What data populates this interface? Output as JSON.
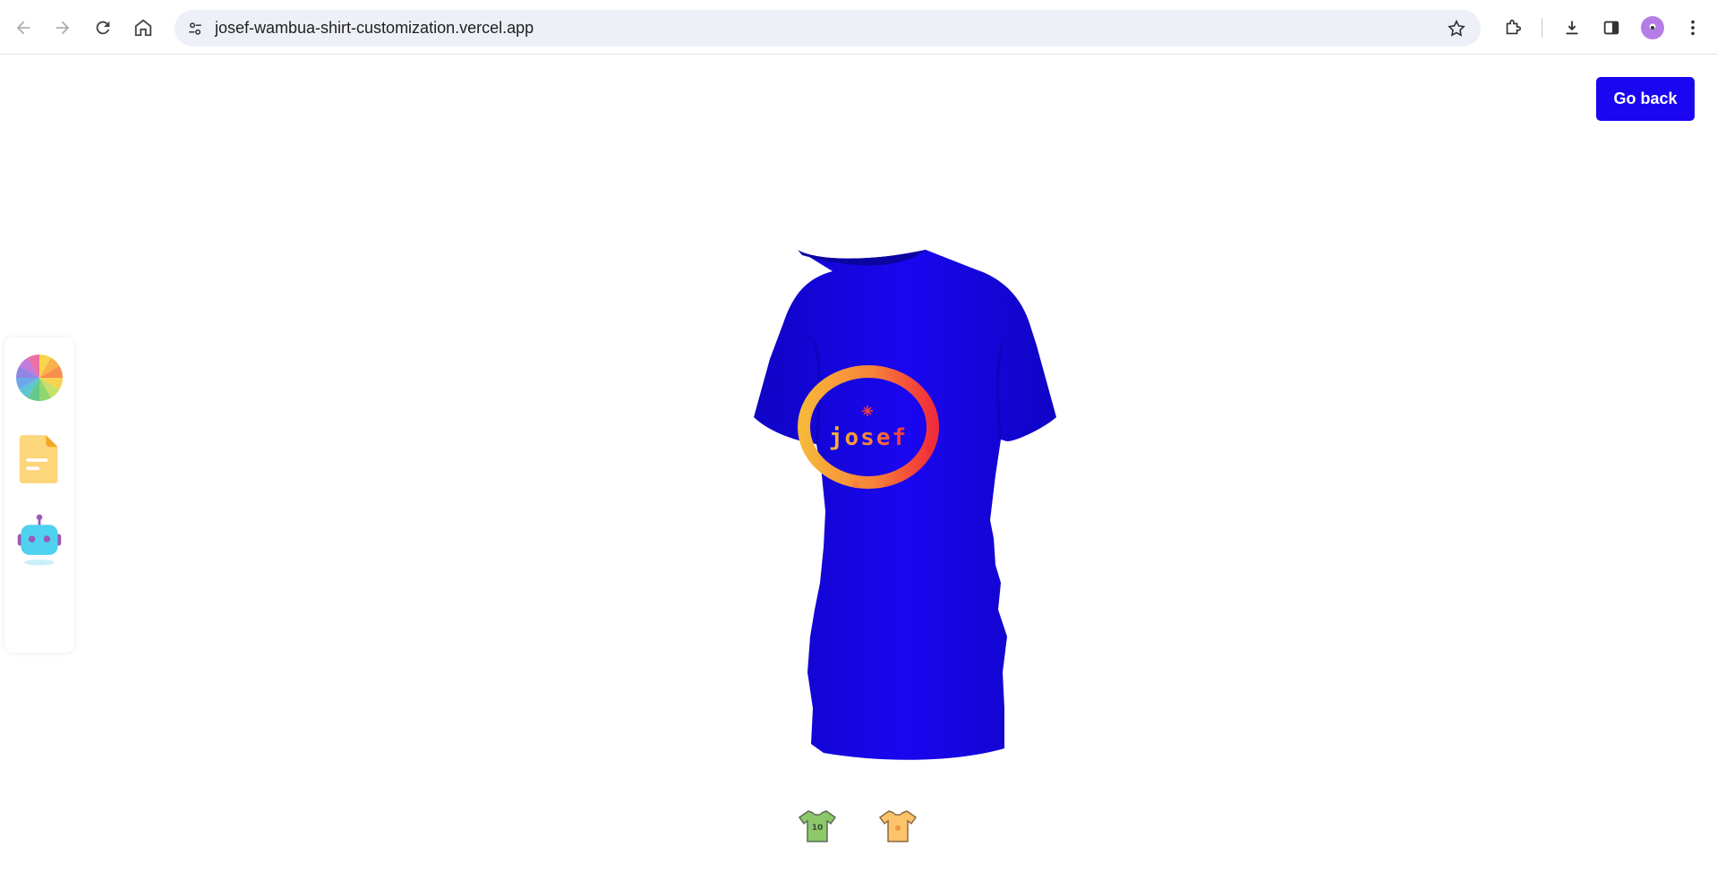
{
  "browser": {
    "url": "josef-wambua-shirt-customization.vercel.app",
    "icons": [
      "back-icon",
      "forward-icon",
      "reload-icon",
      "home-icon",
      "tune-icon",
      "star-icon",
      "extensions-icon",
      "download-icon",
      "side-panel-icon",
      "profile-avatar",
      "more-icon"
    ]
  },
  "header": {
    "go_back_label": "Go back"
  },
  "sidebar": {
    "tools": [
      {
        "name": "color-picker",
        "icon": "color-wheel-icon"
      },
      {
        "name": "file-picker",
        "icon": "file-icon"
      },
      {
        "name": "ai-picker",
        "icon": "robot-icon"
      }
    ]
  },
  "shirt": {
    "color": "#1a06f0",
    "logo_text": "josef"
  },
  "filter_tabs": [
    {
      "name": "logo-shirt",
      "icon": "logo-shirt-icon",
      "label": "10"
    },
    {
      "name": "stylish-shirt",
      "icon": "stylish-shirt-icon"
    }
  ],
  "colors": {
    "accent": "#1a06f0"
  }
}
